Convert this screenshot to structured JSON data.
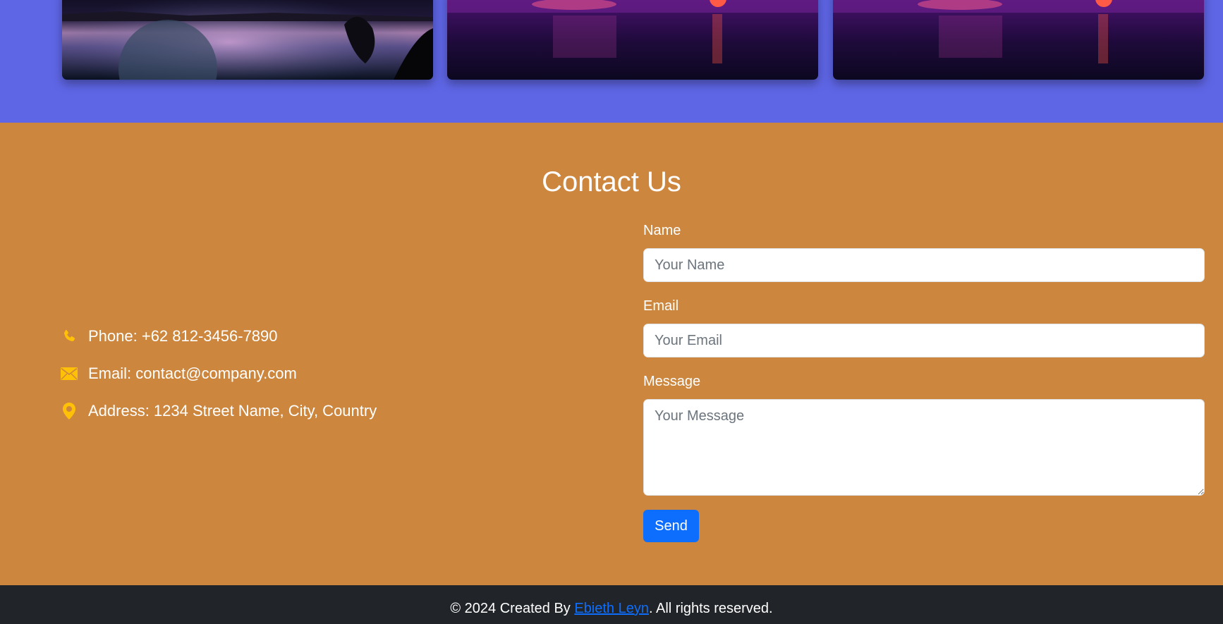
{
  "gallery": {
    "background": "#5f66e6",
    "cards": [
      {
        "image": "night-lake-planet-reflection"
      },
      {
        "image": "purple-fireworks-over-sea"
      },
      {
        "image": "purple-fireworks-over-sea"
      }
    ]
  },
  "contact": {
    "background": "#cd863d",
    "title": "Contact Us",
    "info": {
      "phone": "Phone: +62 812-3456-7890",
      "email": "Email: contact@company.com",
      "address": "Address: 1234 Street Name, City, Country",
      "icon_color": "#ffc107"
    },
    "form": {
      "name_label": "Name",
      "name_placeholder": "Your Name",
      "name_value": "",
      "email_label": "Email",
      "email_placeholder": "Your Email",
      "email_value": "",
      "message_label": "Message",
      "message_placeholder": "Your Message",
      "message_value": "",
      "send_label": "Send",
      "send_color": "#0d6efd"
    }
  },
  "footer": {
    "prefix": "© 2024 Created By ",
    "author": "Ebieth Leyn",
    "suffix": ". All rights reserved.",
    "background": "#212529"
  }
}
